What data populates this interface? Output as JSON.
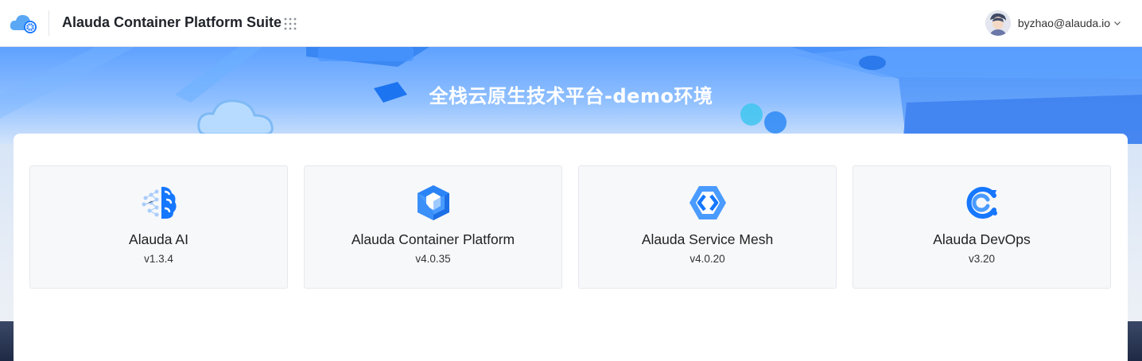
{
  "header": {
    "app_title": "Alauda Container Platform Suite",
    "logo_icon": "cloud-kubernetes-logo-icon",
    "apps_icon": "grid-dots-icon",
    "user": {
      "email": "byzhao@alauda.io",
      "avatar_icon": "user-avatar",
      "menu_icon": "chevron-down-icon"
    }
  },
  "banner": {
    "title": "全栈云原生技术平台-demo环境"
  },
  "products": [
    {
      "name": "Alauda AI",
      "version": "v1.3.4",
      "icon": "brain-icon"
    },
    {
      "name": "Alauda Container Platform",
      "version": "v4.0.35",
      "icon": "cube-icon"
    },
    {
      "name": "Alauda Service Mesh",
      "version": "v4.0.20",
      "icon": "hexagon-mesh-icon"
    },
    {
      "name": "Alauda DevOps",
      "version": "v3.20",
      "icon": "devops-cycle-icon"
    }
  ],
  "colors": {
    "primary": "#1677ff",
    "banner_top": "#5ea1ff",
    "card_bg": "#f7f8fa",
    "header_bg": "#ffffff"
  }
}
